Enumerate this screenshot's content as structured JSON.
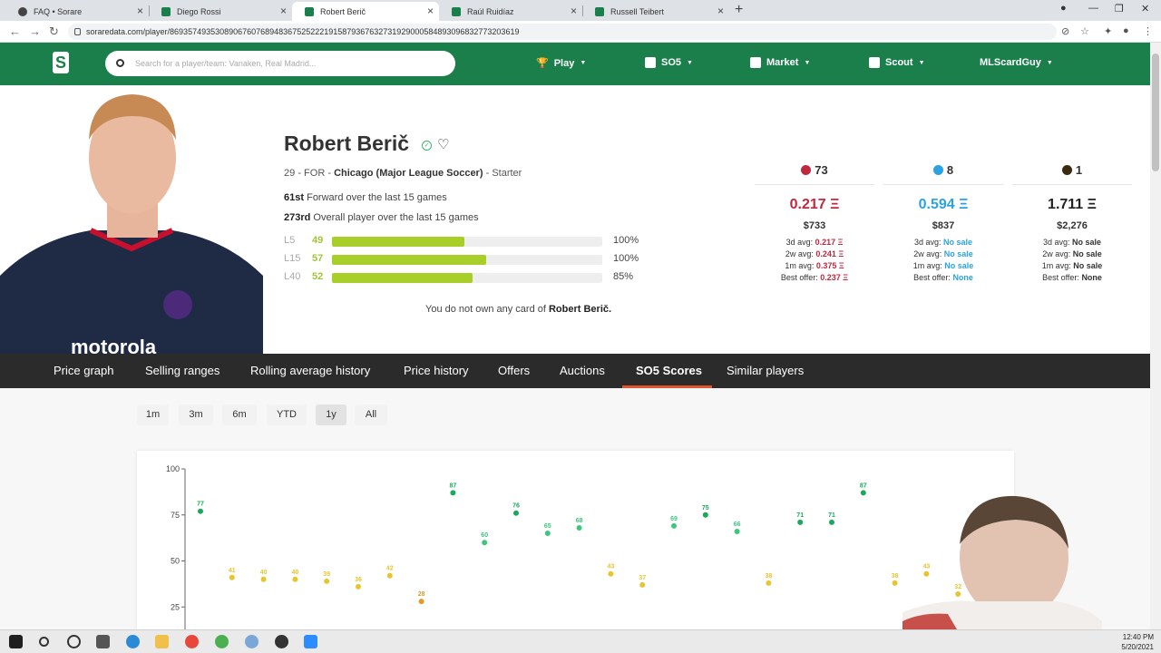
{
  "browser": {
    "tabs": [
      {
        "title": "FAQ • Sorare",
        "color": "#555"
      },
      {
        "title": "Diego Rossi",
        "color": "#1a7f4b"
      },
      {
        "title": "Robert Berič",
        "color": "#1a7f4b"
      },
      {
        "title": "Raúl Ruidíaz",
        "color": "#1a7f4b"
      },
      {
        "title": "Russell Teibert",
        "color": "#1a7f4b"
      }
    ],
    "url": "soraredata.com/player/86935749353089067607689483675252221915879367632731929000584893096832773203619"
  },
  "site": {
    "search_placeholder": "Search for a player/team: Vanaken, Real Madrid...",
    "nav": [
      "Play",
      "SO5",
      "Market",
      "Scout",
      "MLScardGuy"
    ]
  },
  "player": {
    "name": "Robert Berič",
    "age": "29",
    "position": "FOR",
    "team": "Chicago (Major League Soccer)",
    "status": "Starter",
    "rank1_pos": "61st",
    "rank1_text": "Forward over the last 15 games",
    "rank2_pos": "273rd",
    "rank2_text": "Overall player over the last 15 games",
    "sep1": "-",
    "sep2": "-",
    "l5": {
      "label": "L5",
      "value": "49",
      "pct": "100%"
    },
    "l15": {
      "label": "L15",
      "value": "57",
      "pct": "100%"
    },
    "l40": {
      "label": "L40",
      "value": "52",
      "pct": "85%"
    },
    "no_own_text": "You do not own any card of",
    "no_own_name": "Robert Berič."
  },
  "cards": [
    {
      "count": "73",
      "color": "#c0283e",
      "eth": "0.217 Ξ",
      "usd": "$733",
      "avg3d": "0.217 Ξ",
      "avg2w": "0.241 Ξ",
      "avg1m": "0.375 Ξ",
      "best": "0.237 Ξ"
    },
    {
      "count": "8",
      "color": "#2ba3e3",
      "eth": "0.594 Ξ",
      "usd": "$837",
      "avg3d": "No sale",
      "avg2w": "No sale",
      "avg1m": "No sale",
      "best": "None"
    },
    {
      "count": "1",
      "color": "#3a2a10",
      "eth": "1.711 Ξ",
      "usd": "$2,276",
      "avg3d": "No sale",
      "avg2w": "No sale",
      "avg1m": "No sale",
      "best": "None"
    }
  ],
  "card_labels": {
    "avg3d": "3d avg:",
    "avg2w": "2w avg:",
    "avg1m": "1m avg:",
    "best": "Best offer:"
  },
  "page_tabs": [
    "Price graph",
    "Selling ranges",
    "Rolling average history",
    "Price history",
    "Offers",
    "Auctions",
    "SO5 Scores",
    "Similar players"
  ],
  "range_buttons": [
    "1m",
    "3m",
    "6m",
    "YTD",
    "1y",
    "All"
  ],
  "taskbar": {
    "time": "12:40 PM",
    "date": "5/20/2021"
  },
  "chart_data": {
    "type": "scatter",
    "title": "",
    "xlabel": "",
    "ylabel": "",
    "ylim": [
      0,
      100
    ],
    "yticks": [
      25,
      50,
      75,
      100
    ],
    "points": [
      77,
      41,
      40,
      40,
      39,
      36,
      42,
      28,
      87,
      60,
      76,
      65,
      68,
      43,
      37,
      69,
      75,
      66,
      38,
      71,
      71,
      87,
      38,
      43,
      32
    ],
    "colors": {
      "high": "#1aa85c",
      "mid": "#3cc77d",
      "low": "#e6c52e",
      "vlow": "#e09a2a"
    }
  }
}
